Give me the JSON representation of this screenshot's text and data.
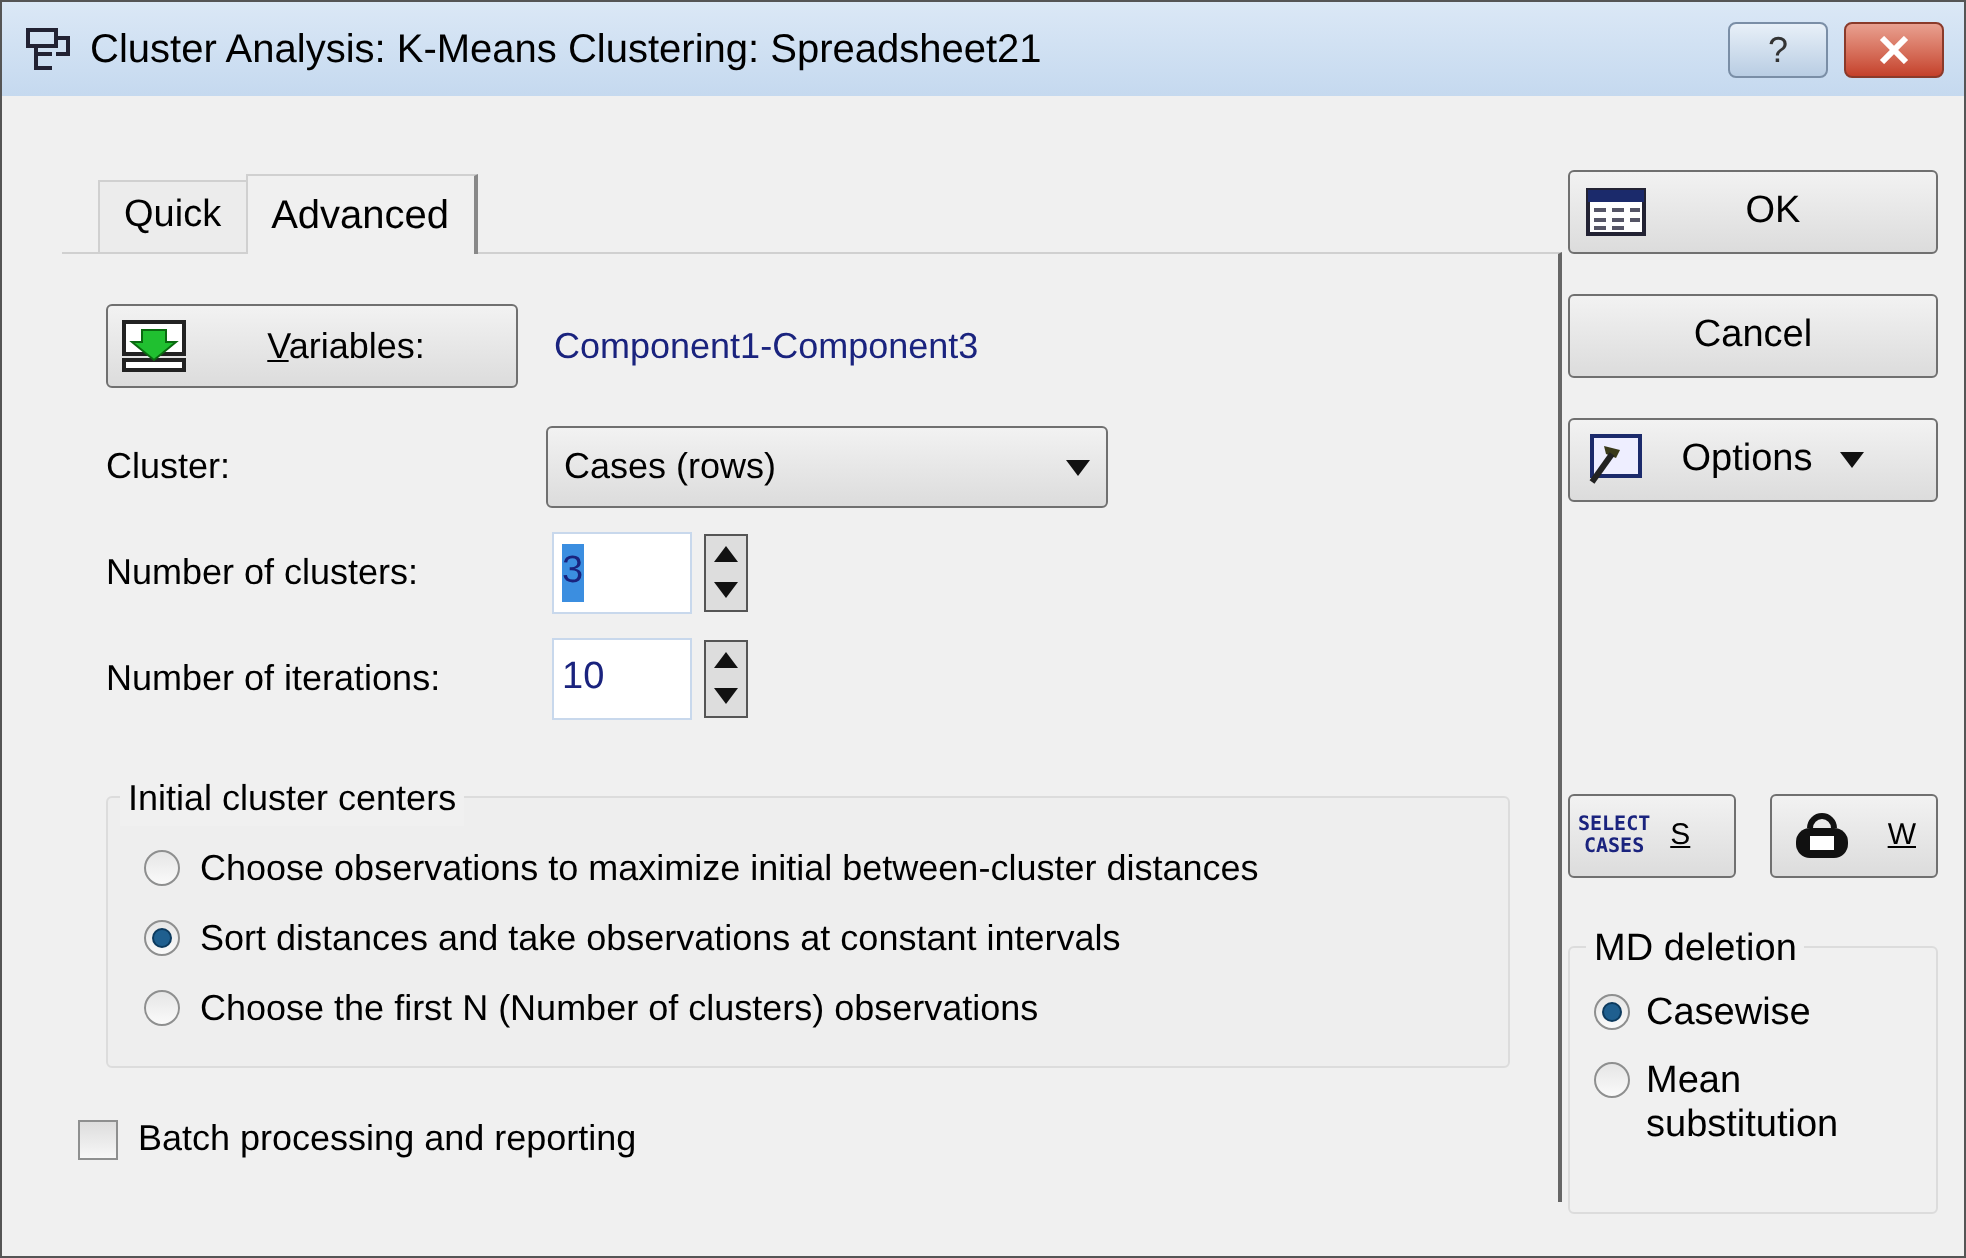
{
  "window": {
    "title": "Cluster Analysis: K-Means Clustering: Spreadsheet21",
    "help_button": "?"
  },
  "tabs": [
    {
      "label": "Quick",
      "selected": false
    },
    {
      "label": "Advanced",
      "selected": true
    }
  ],
  "variables_button": {
    "accel": "V",
    "rest": "ariables:"
  },
  "variables_value": "Component1-Component3",
  "cluster": {
    "label": "Cluster:",
    "value": "Cases (rows)"
  },
  "spinners": [
    {
      "label": "Number of clusters:",
      "value": "3",
      "text_selected": true
    },
    {
      "label": "Number of iterations:",
      "value": "10",
      "text_selected": false
    }
  ],
  "initial_centers": {
    "title": "Initial cluster centers",
    "options": [
      {
        "label": "Choose observations to maximize initial between-cluster distances",
        "selected": false
      },
      {
        "label": "Sort distances and take observations at constant intervals",
        "selected": true
      },
      {
        "label": "Choose the first N (Number of clusters) observations",
        "selected": false
      }
    ]
  },
  "batch": {
    "label": "Batch processing and reporting",
    "checked": false
  },
  "buttons": [
    {
      "kind": "ok",
      "label": "OK"
    },
    {
      "kind": "cancel",
      "label": "Cancel"
    },
    {
      "kind": "options",
      "label": "Options"
    }
  ],
  "select_cases": {
    "icon_text_1": "SELECT",
    "icon_text_2": "CASES",
    "accel": "S"
  },
  "weights": {
    "accel": "W"
  },
  "md_deletion": {
    "title": "MD deletion",
    "options": [
      {
        "label": "Casewise",
        "selected": true
      },
      {
        "label": "Mean substitution",
        "selected": false
      }
    ]
  }
}
